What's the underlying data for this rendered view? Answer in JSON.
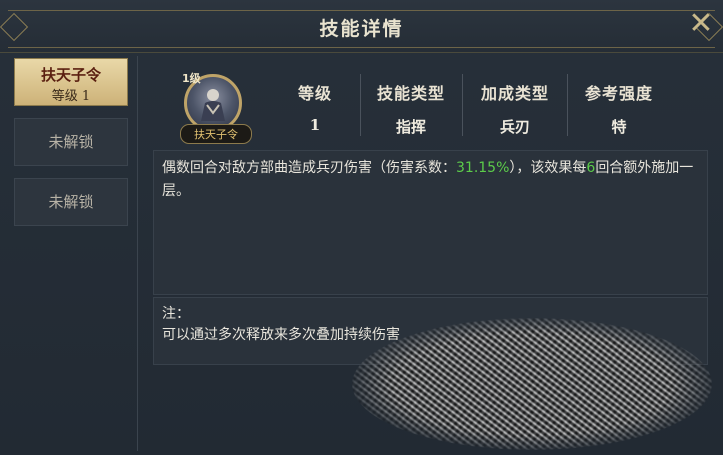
{
  "window": {
    "title": "技能详情"
  },
  "tabs": [
    {
      "name": "扶天子令",
      "level": "等级 1"
    },
    {
      "label": "未解锁"
    },
    {
      "label": "未解锁"
    }
  ],
  "skill": {
    "level_badge": "1级",
    "icon_label": "扶天子令",
    "stats": [
      {
        "label": "等级",
        "value": "1"
      },
      {
        "label": "技能类型",
        "value": "指挥"
      },
      {
        "label": "加成类型",
        "value": "兵刃"
      },
      {
        "label": "参考强度",
        "value": "特"
      }
    ],
    "description": {
      "part1": "偶数回合对敌方部曲造成兵刃伤害（伤害系数：",
      "coef": "31.15%",
      "part2": "），该效果每",
      "rounds": "6",
      "part3": "回合额外施加一层。"
    },
    "note": {
      "heading": "注：",
      "text": "可以通过多次释放来多次叠加持续伤害"
    }
  },
  "colors": {
    "highlight_green": "#5ccc4a",
    "gold_frame": "#bfa468"
  }
}
